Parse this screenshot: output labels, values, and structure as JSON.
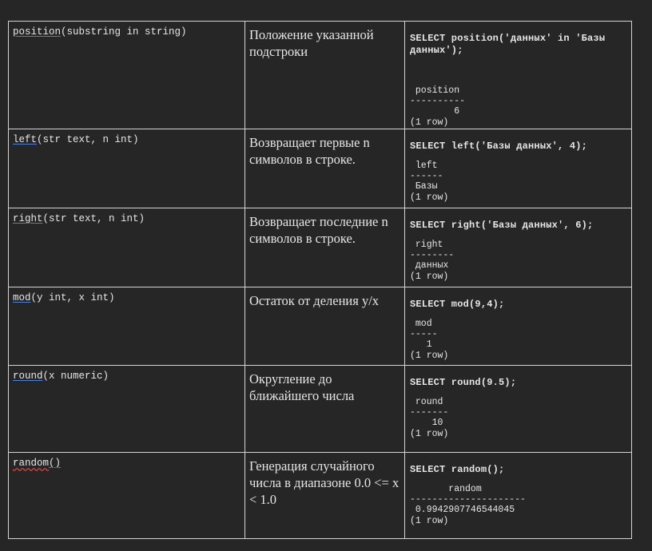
{
  "rows": [
    {
      "sig_name": "position",
      "sig_args": "(substring in string)",
      "description": "Положение указанной подстроки",
      "query": "SELECT position('данных' in 'Базы данных');",
      "result": " position\n----------\n        6\n(1 row)"
    },
    {
      "sig_name": "left",
      "sig_args": "(str text, n int)",
      "description": "Возвращает первые n символов в строке.",
      "query": "SELECT left('Базы данных', 4);",
      "result": " left\n------\n Базы\n(1 row)"
    },
    {
      "sig_name": "right",
      "sig_args": "(str text, n int)",
      "description": "Возвращает последние n символов в строке.",
      "query": "SELECT right('Базы данных', 6);",
      "result": " right\n--------\n данных\n(1 row)"
    },
    {
      "sig_name": "mod",
      "sig_args": "(y int, x int)",
      "description": "Остаток от деления y/x",
      "query": "SELECT mod(9,4);",
      "result": " mod\n-----\n   1\n(1 row)"
    },
    {
      "sig_name": "round",
      "sig_args": "(x numeric)",
      "description": "Округление до ближайшего числа",
      "query": "SELECT round(9.5);",
      "result": " round\n-------\n    10\n(1 row)"
    },
    {
      "sig_name": "random",
      "sig_args": "()",
      "description": "Генерация случайного числа в диапазоне 0.0 <= x < 1.0",
      "query": "SELECT random();",
      "result": "       random\n---------------------\n 0.9942907746544045\n(1 row)"
    }
  ]
}
